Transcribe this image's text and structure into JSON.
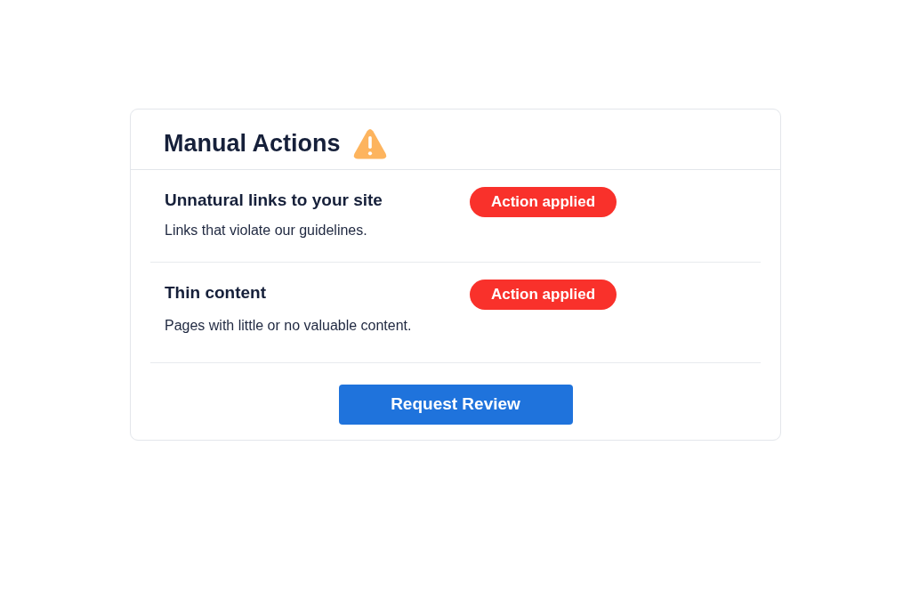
{
  "panel": {
    "title": "Manual Actions"
  },
  "actions": [
    {
      "title": "Unnatural links to your site",
      "description": "Links that violate our guidelines.",
      "status": "Action applied"
    },
    {
      "title": "Thin content",
      "description": "Pages with little or no valuable content.",
      "status": "Action applied"
    }
  ],
  "primary_button": "Request Review"
}
